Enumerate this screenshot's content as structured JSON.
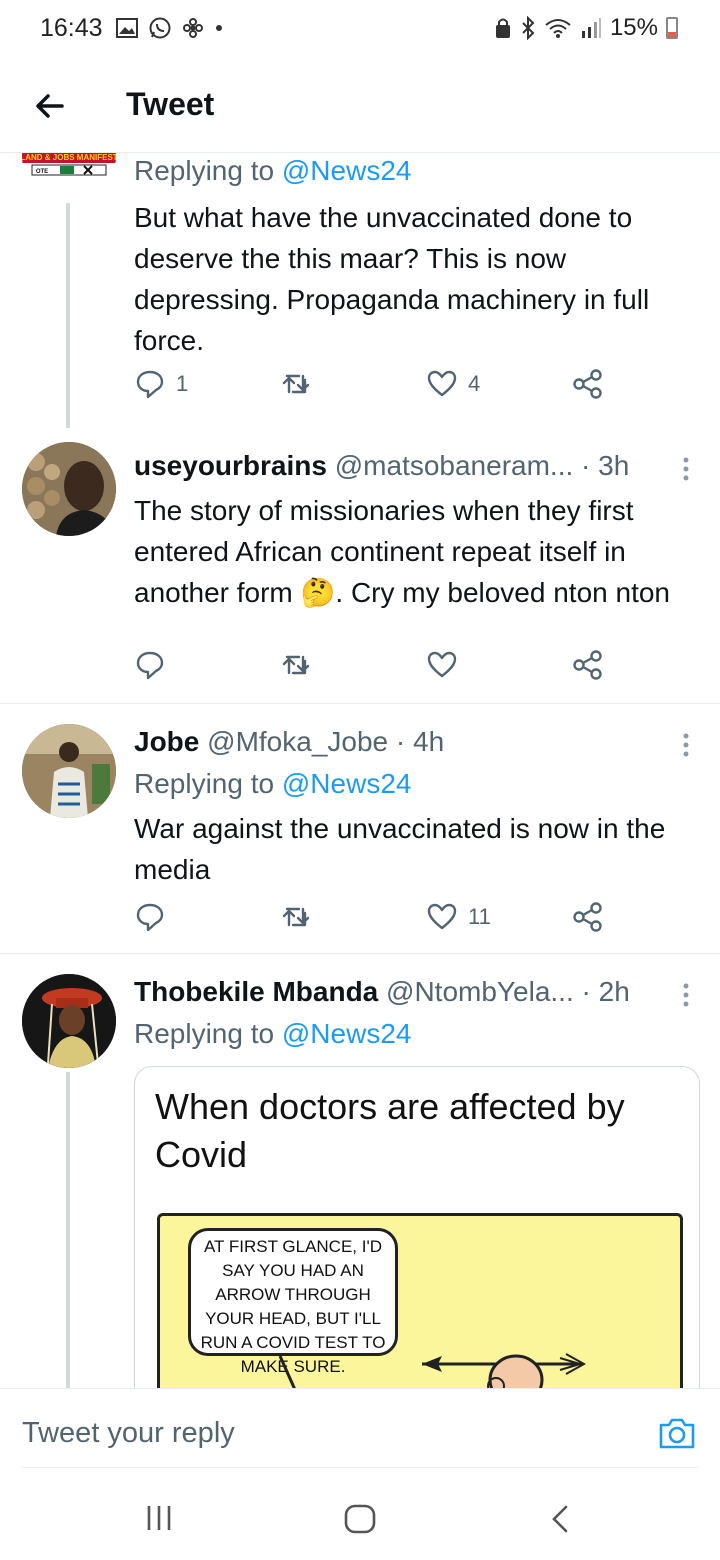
{
  "status_bar": {
    "time": "16:43",
    "battery": "15%",
    "left_icons": [
      "gallery-icon",
      "whatsapp-icon",
      "fan-icon",
      "dot-icon"
    ],
    "right_icons": [
      "lock-icon",
      "bluetooth-icon",
      "wifi-icon",
      "signal-icon",
      "battery-icon"
    ]
  },
  "header": {
    "title": "Tweet",
    "back_icon": "arrow-left-icon"
  },
  "tweets": [
    {
      "replying_prefix": "Replying to ",
      "replying_to": "@News24",
      "avatar_text": "LAND & JOBS MANIFEST",
      "text": "But what have the unvaccinated done to deserve the this maar? This is now depressing. Propaganda machinery in full force.",
      "replies": "1",
      "retweets": "",
      "likes": "4"
    },
    {
      "name": "useyourbrains",
      "handle": "@matsobaneram...",
      "time": "· 3h",
      "text": "The story of missionaries when they first entered African continent repeat itself in another form 🤔. Cry my beloved nton nton",
      "replies": "",
      "retweets": "",
      "likes": ""
    },
    {
      "name": "Jobe",
      "handle": "@Mfoka_Jobe",
      "time": "· 4h",
      "replying_prefix": "Replying to ",
      "replying_to": "@News24",
      "text": "War against the unvaccinated is now in the media",
      "replies": "",
      "retweets": "",
      "likes": "11"
    },
    {
      "name": "Thobekile Mbanda",
      "handle": "@NtombYela...",
      "time": "· 2h",
      "replying_prefix": "Replying to ",
      "replying_to": "@News24",
      "media": {
        "title": "When doctors are affected by Covid",
        "speech_bubble": "AT FIRST GLANCE, I'D SAY YOU HAD AN ARROW THROUGH YOUR HEAD, BUT I'LL RUN A COVID TEST TO MAKE SURE."
      }
    }
  ],
  "reply_bar": {
    "placeholder": "Tweet your reply"
  },
  "colors": {
    "accent": "#1d9bf0",
    "secondary_text": "#536471",
    "divider": "#e6ecf0"
  }
}
